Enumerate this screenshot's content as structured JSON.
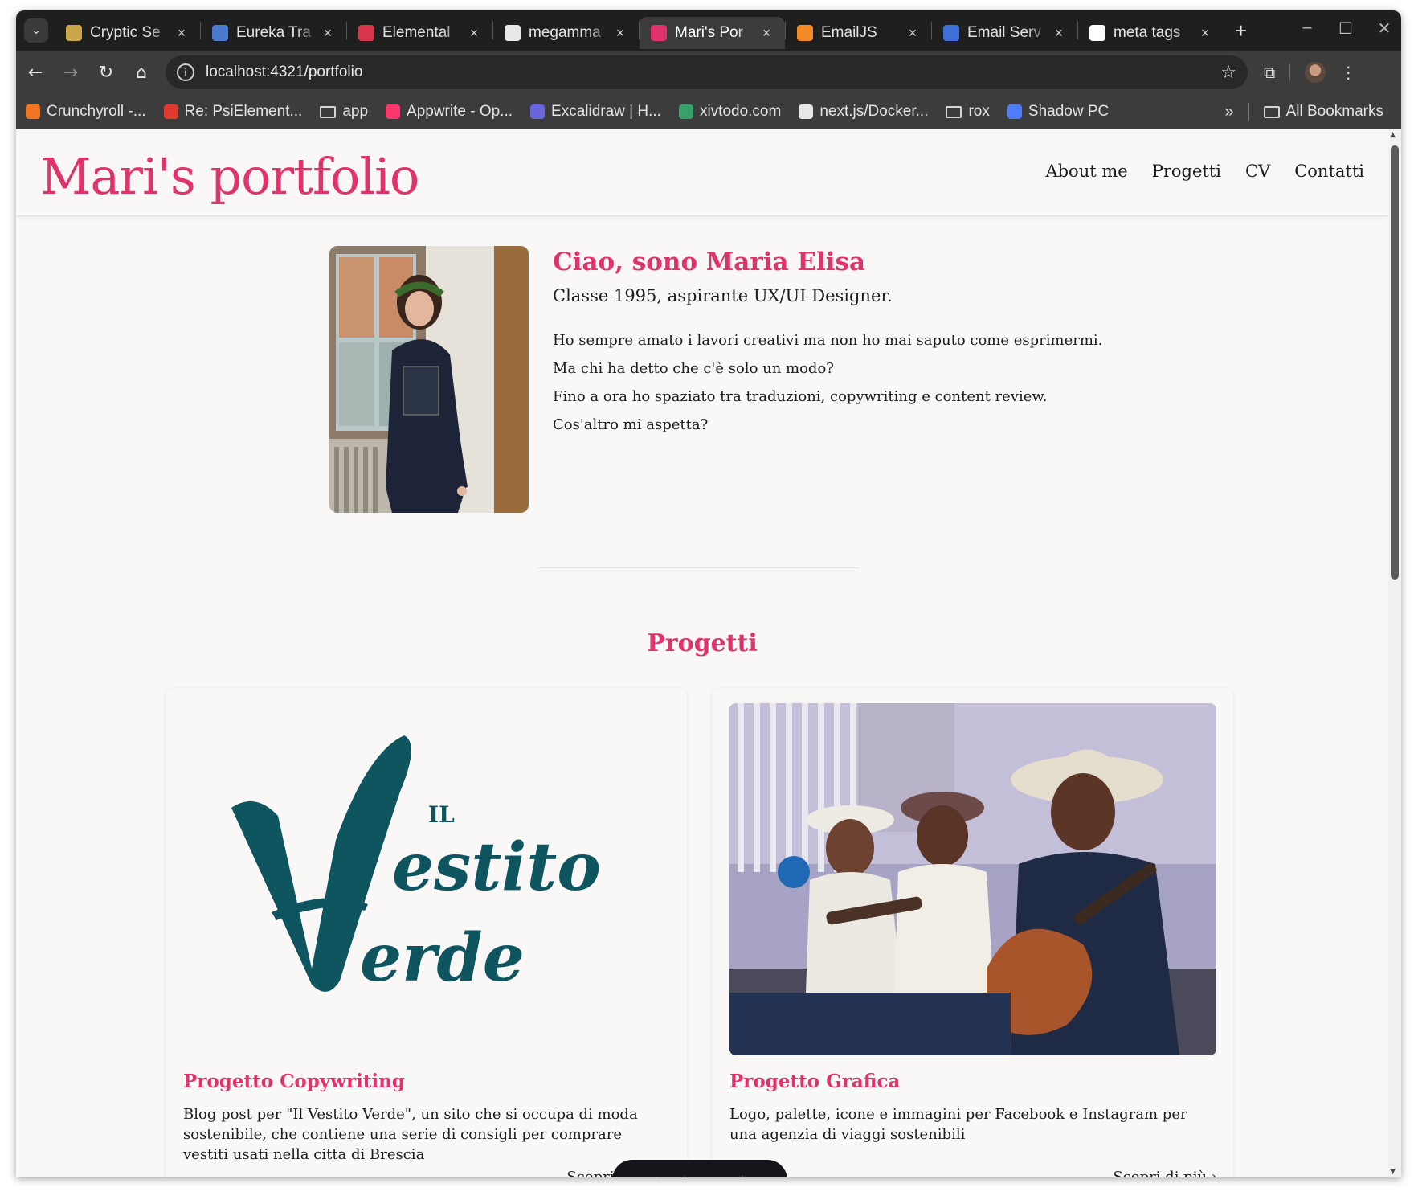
{
  "browser": {
    "tabs": [
      {
        "title": "Cryptic Se",
        "icon_color": "#c9a64a",
        "icon": "coin-icon"
      },
      {
        "title": "Eureka Tra",
        "icon_color": "#4a7bd1",
        "icon": "gear-icon"
      },
      {
        "title": "Elemental",
        "icon_color": "#d9364b",
        "icon": "swirl-icon"
      },
      {
        "title": "megamma",
        "icon_color": "#e8e8e8",
        "icon": "github-icon"
      },
      {
        "title": "Mari's Por",
        "icon_color": "#e0336e",
        "icon": "m-icon",
        "active": true
      },
      {
        "title": "EmailJS",
        "icon_color": "#f08a24",
        "icon": "emailjs-icon"
      },
      {
        "title": "Email Serv",
        "icon_color": "#3e6fd9",
        "icon": "shield-icon"
      },
      {
        "title": "meta tags",
        "icon_color": "#ffffff",
        "icon": "google-icon"
      }
    ],
    "url": "localhost:4321/portfolio",
    "bookmarks": [
      {
        "label": "Crunchyroll -...",
        "color": "#f47521",
        "type": "site"
      },
      {
        "label": "Re: PsiElement...",
        "color": "#e03a2f",
        "type": "site"
      },
      {
        "label": "app",
        "type": "folder"
      },
      {
        "label": "Appwrite - Op...",
        "color": "#fd366e",
        "type": "site"
      },
      {
        "label": "Excalidraw | H...",
        "color": "#6965db",
        "type": "site"
      },
      {
        "label": "xivtodo.com",
        "color": "#38a169",
        "type": "site"
      },
      {
        "label": "next.js/Docker...",
        "color": "#e8e8e8",
        "type": "site"
      },
      {
        "label": "rox",
        "type": "folder"
      },
      {
        "label": "Shadow PC",
        "color": "#4f7cf7",
        "type": "site"
      }
    ],
    "more_bookmarks": "»",
    "all_bookmarks": "All Bookmarks"
  },
  "site": {
    "brand": "Mari's portfolio",
    "nav": [
      "About me",
      "Progetti",
      "CV",
      "Contatti"
    ],
    "accent": "#e0336e"
  },
  "hero": {
    "title": "Ciao, sono Maria Elisa",
    "subtitle": "Classe 1995, aspirante UX/UI Designer.",
    "paragraphs": [
      "Ho sempre amato i lavori creativi ma non ho mai saputo come esprimermi.",
      "Ma chi ha detto che c'è solo un modo?",
      "Fino a ora ho spaziato tra traduzioni, copywriting e content review.",
      "Cos'altro mi aspetta?"
    ]
  },
  "projects": {
    "title": "Progetti",
    "cards": [
      {
        "title": "Progetto Copywriting",
        "description": "Blog post per \"Il Vestito Verde\", un sito che si occupa di moda sostenibile, che contiene una serie di consigli per comprare vestiti usati nella citta di Brescia",
        "logo_small": "IL",
        "logo_word1": "estito",
        "logo_word2": "erde",
        "logo_color": "#0f5560",
        "more": "Scopri di più"
      },
      {
        "title": "Progetto Grafica",
        "description": "Logo, palette, icone e immagini per Facebook e Instagram per una agenzia di viaggi sostenibili",
        "more": "Scopri di più"
      }
    ]
  }
}
